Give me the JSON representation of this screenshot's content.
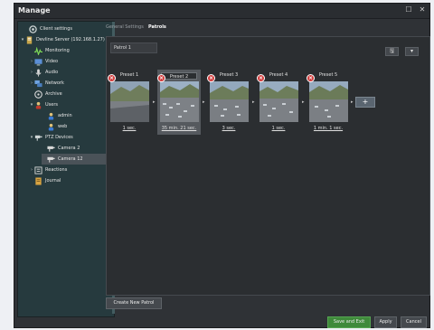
{
  "window": {
    "title": "Manage"
  },
  "sidebar": {
    "items": [
      {
        "label": "Client settings",
        "icon": "client-settings-icon"
      },
      {
        "label": "Devline Server (192.168.1.27)",
        "icon": "server-icon"
      },
      {
        "label": "Monitoring",
        "icon": "monitoring-icon"
      },
      {
        "label": "Video",
        "icon": "video-icon"
      },
      {
        "label": "Audio",
        "icon": "audio-icon"
      },
      {
        "label": "Network",
        "icon": "network-icon"
      },
      {
        "label": "Archive",
        "icon": "archive-icon"
      },
      {
        "label": "Users",
        "icon": "users-icon"
      },
      {
        "label": "admin",
        "icon": "user-icon"
      },
      {
        "label": "web",
        "icon": "user-icon"
      },
      {
        "label": "PTZ Devices",
        "icon": "ptz-icon"
      },
      {
        "label": "Camera 2",
        "icon": "camera-icon"
      },
      {
        "label": "Camera 12",
        "icon": "camera-icon"
      },
      {
        "label": "Reactions",
        "icon": "reactions-icon"
      },
      {
        "label": "Journal",
        "icon": "journal-icon"
      }
    ]
  },
  "tabs": [
    {
      "label": "General Settings"
    },
    {
      "label": "Patrols"
    }
  ],
  "patrol": {
    "name": "Patrol 1"
  },
  "presets": [
    {
      "name": "Preset 1",
      "duration": "1 sec."
    },
    {
      "name": "Preset 2",
      "duration": "35 min. 21 sec."
    },
    {
      "name": "Preset 3",
      "duration": "3 sec."
    },
    {
      "name": "Preset 4",
      "duration": "1 sec."
    },
    {
      "name": "Preset 5",
      "duration": "1 min. 1 sec."
    }
  ],
  "buttons": {
    "add_preset": "+",
    "create_new_patrol": "Create New Patrol",
    "save_and_exit": "Save and Exit",
    "apply": "Apply",
    "cancel": "Cancel",
    "minimize": "☐",
    "close": "✕",
    "save_icon": "🖫",
    "dropdown": "▾"
  }
}
